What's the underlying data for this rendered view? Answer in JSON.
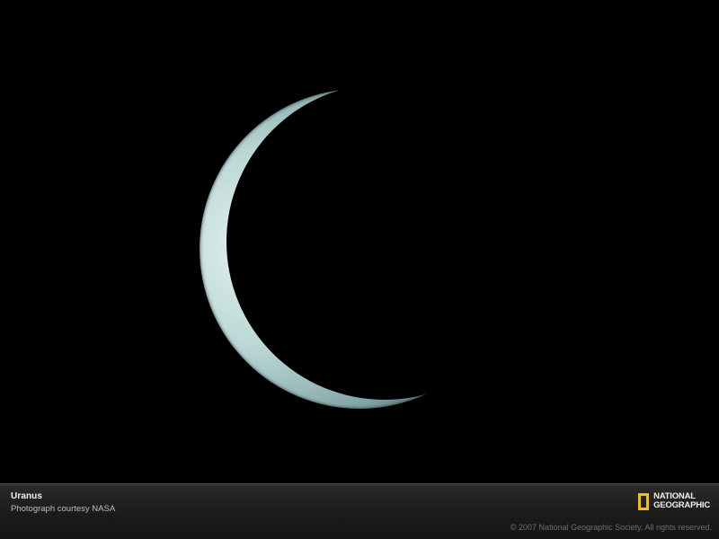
{
  "photo": {
    "subject": "Uranus"
  },
  "caption": {
    "title": "Uranus",
    "credit": "Photograph courtesy NASA"
  },
  "branding": {
    "logo_line1": "NATIONAL",
    "logo_line2": "GEOGRAPHIC",
    "logo_color": "#f2c200",
    "copyright": "© 2007 National Geographic Society. All rights reserved."
  },
  "colors": {
    "background": "#000000",
    "crescent_light": "#cfe6e4",
    "crescent_mid": "#8fb4b6"
  }
}
